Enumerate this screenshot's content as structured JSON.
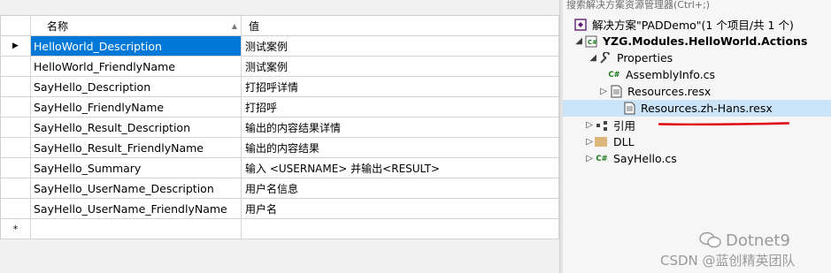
{
  "grid": {
    "columns": {
      "name": "名称",
      "value": "值"
    },
    "rows": [
      {
        "name": "HelloWorld_Description",
        "value": "测试案例",
        "selected": true
      },
      {
        "name": "HelloWorld_FriendlyName",
        "value": "测试案例"
      },
      {
        "name": "SayHello_Description",
        "value": "打招呼详情"
      },
      {
        "name": "SayHello_FriendlyName",
        "value": "打招呼"
      },
      {
        "name": "SayHello_Result_Description",
        "value": "输出的内容结果详情"
      },
      {
        "name": "SayHello_Result_FriendlyName",
        "value": "输出的内容结果"
      },
      {
        "name": "SayHello_Summary",
        "value": "输入 <USERNAME> 并输出<RESULT>"
      },
      {
        "name": "SayHello_UserName_Description",
        "value": "用户名信息"
      },
      {
        "name": "SayHello_UserName_FriendlyName",
        "value": "用户名"
      }
    ],
    "new_row_marker": "*",
    "current_row_marker": "▶"
  },
  "solution_explorer": {
    "search_placeholder": "搜索解决方案资源管理器(Ctrl+;)",
    "solution": "解决方案\"PADDemo\"(1 个项目/共 1 个)",
    "project": "YZG.Modules.HelloWorld.Actions",
    "properties": "Properties",
    "assembly_info": "AssemblyInfo.cs",
    "resources": "Resources.resx",
    "resources_zh": "Resources.zh-Hans.resx",
    "references": "引用",
    "dll": "DLL",
    "sayhello": "SayHello.cs"
  },
  "watermark": {
    "line1": "Dotnet9",
    "line2": "CSDN @蓝创精英团队"
  },
  "colors": {
    "selection": "#0078d7",
    "tree_selection": "#cce4f7",
    "highlight_underline": "#e0000e"
  }
}
